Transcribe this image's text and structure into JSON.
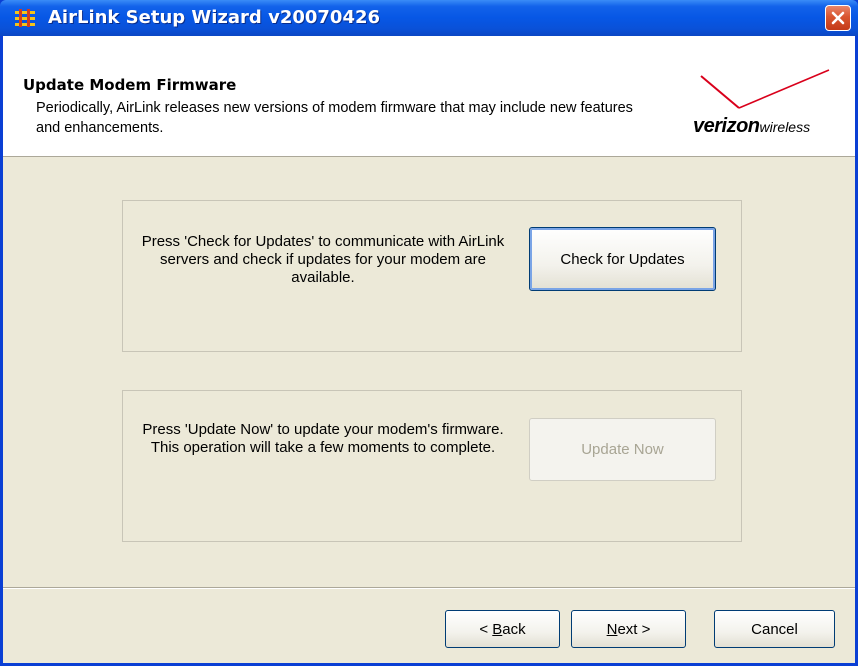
{
  "window": {
    "title": "AirLink Setup Wizard v20070426",
    "title_color": "#0757e5"
  },
  "header": {
    "title": "Update Modem Firmware",
    "description": "Periodically, AirLink releases new versions of modem firmware that may include new features and enhancements.",
    "logo_text_bold": "verizon",
    "logo_text_light": "wireless"
  },
  "check_group": {
    "instructions": "Press 'Check for Updates' to communicate with AirLink servers and check if updates for your modem are available.",
    "button_label": "Check for Updates"
  },
  "update_group": {
    "instructions": "Press 'Update Now' to update your modem's firmware. This operation will take a few moments to complete.",
    "button_label": "Update Now",
    "button_enabled": false
  },
  "footer": {
    "back_label_pre": "< ",
    "back_label_u": "B",
    "back_label_post": "ack",
    "next_label_u": "N",
    "next_label_post": "ext >",
    "cancel_label": "Cancel"
  },
  "colors": {
    "accent_red": "#d9001b",
    "dialog_bg": "#ece9d8"
  }
}
